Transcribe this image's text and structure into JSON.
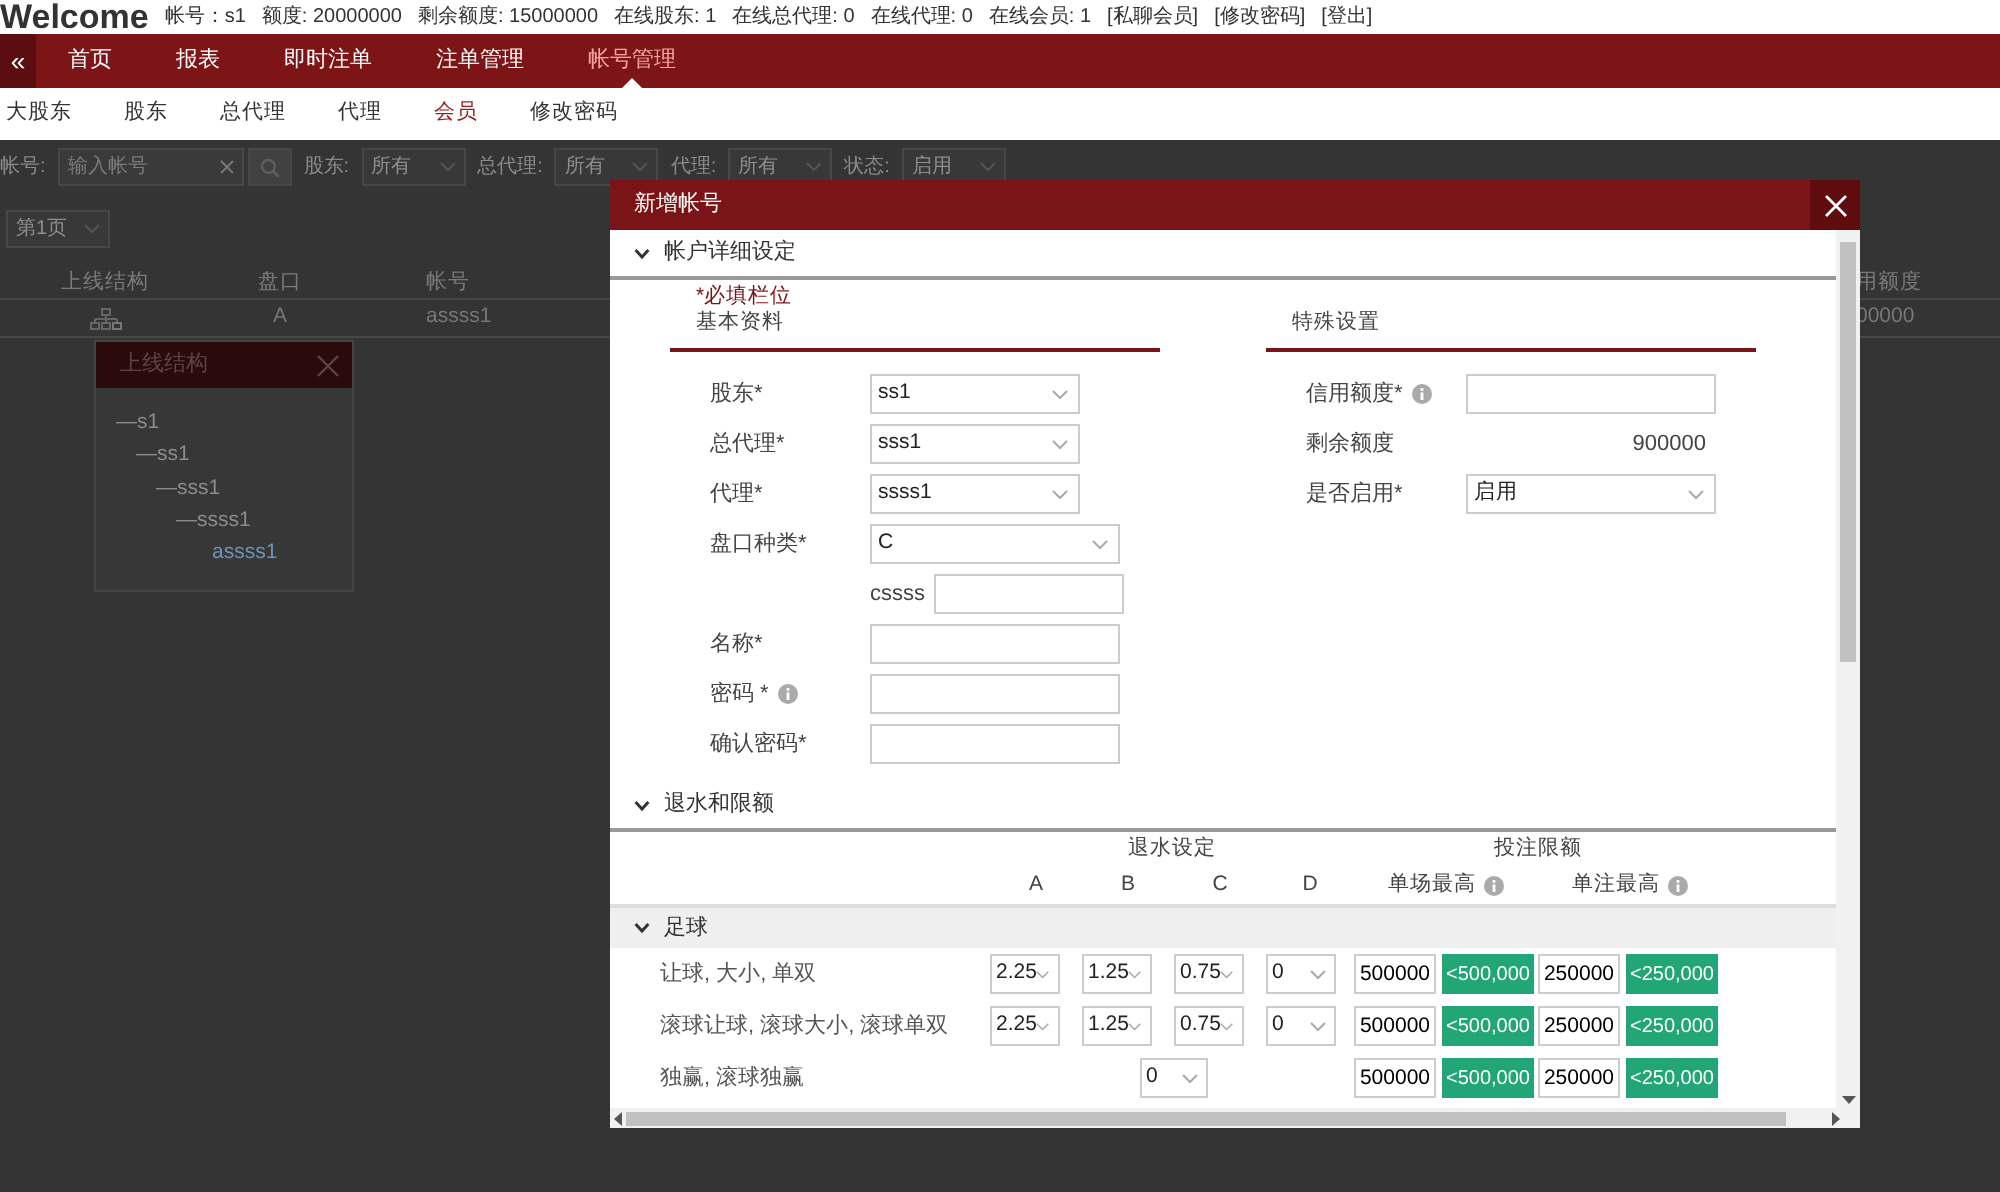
{
  "top_bar": {
    "title": "Welcome",
    "stats": [
      "帐号：s1",
      "额度: 20000000",
      "剩余额度: 15000000",
      "在线股东: 1",
      "在线总代理: 0",
      "在线代理: 0",
      "在线会员: 1"
    ],
    "links": [
      "[私聊会员]",
      "[修改密码]",
      "[登出]"
    ]
  },
  "main_nav": {
    "toggle": "«",
    "items": [
      {
        "label": "首页",
        "selected": false
      },
      {
        "label": "报表",
        "selected": false
      },
      {
        "label": "即时注单",
        "selected": false
      },
      {
        "label": "注单管理",
        "selected": false
      },
      {
        "label": "帐号管理",
        "selected": true
      }
    ]
  },
  "sub_nav": {
    "items": [
      {
        "label": "大股东",
        "selected": false
      },
      {
        "label": "股东",
        "selected": false
      },
      {
        "label": "总代理",
        "selected": false
      },
      {
        "label": "代理",
        "selected": false
      },
      {
        "label": "会员",
        "selected": true
      },
      {
        "label": "修改密码",
        "selected": false
      }
    ]
  },
  "filters": {
    "account": {
      "label": "帐号:",
      "placeholder": "输入帐号"
    },
    "selects": [
      {
        "label": "股东:",
        "value": "所有"
      },
      {
        "label": "总代理:",
        "value": "所有"
      },
      {
        "label": "代理:",
        "value": "所有"
      },
      {
        "label": "状态:",
        "value": "启用"
      }
    ]
  },
  "pager": {
    "value": "第1页"
  },
  "table": {
    "columns": [
      "上线结构",
      "盘口",
      "帐号",
      "用额度"
    ],
    "rows": [
      {
        "cells": [
          {
            "kind": "icon"
          },
          {
            "kind": "text",
            "text": "A"
          },
          {
            "kind": "text",
            "text": "assss1"
          },
          {
            "kind": "text",
            "text": "00000"
          }
        ]
      }
    ]
  },
  "structure_popup": {
    "title": "上线结构",
    "tree": [
      {
        "label": "—s1",
        "selected": false,
        "children": [
          {
            "label": "—ss1",
            "selected": false,
            "children": [
              {
                "label": "—sss1",
                "selected": false,
                "children": [
                  {
                    "label": "—ssss1",
                    "selected": false,
                    "children": [
                      {
                        "label": "assss1",
                        "selected": true
                      }
                    ]
                  }
                ]
              }
            ]
          }
        ]
      }
    ]
  },
  "modal": {
    "title": "新增帐号",
    "sections": [
      {
        "kind": "form",
        "title": "帐户详细设定",
        "expanded": true,
        "note": "*必填栏位",
        "basic": {
          "title": "基本资料",
          "fields": [
            {
              "kind": "select",
              "label": "股东*",
              "value": "ss1"
            },
            {
              "kind": "select",
              "label": "总代理*",
              "value": "sss1"
            },
            {
              "kind": "select",
              "label": "代理*",
              "value": "ssss1"
            },
            {
              "kind": "select",
              "label": "盘口种类*",
              "value": "C"
            },
            {
              "kind": "prefixed_input",
              "prefix": "cssss"
            },
            {
              "kind": "input",
              "label": "名称*"
            },
            {
              "kind": "input",
              "label": "密码 *",
              "info": true
            },
            {
              "kind": "input",
              "label": "确认密码*"
            }
          ]
        },
        "special": {
          "title": "特殊设置",
          "fields": [
            {
              "kind": "input",
              "label": "信用额度*",
              "info": true
            },
            {
              "kind": "text",
              "label": "剩余额度",
              "value": "900000"
            },
            {
              "kind": "select",
              "label": "是否启用*",
              "value": "启用"
            }
          ]
        }
      },
      {
        "kind": "limits",
        "title": "退水和限额",
        "expanded": true,
        "group_headers": [
          "退水设定",
          "投注限额"
        ],
        "columns": [
          {
            "label": "A"
          },
          {
            "label": "B"
          },
          {
            "label": "C"
          },
          {
            "label": "D"
          },
          {
            "label": "单场最高",
            "info": true
          },
          {
            "label": "单注最高",
            "info": true
          }
        ],
        "categories": [
          {
            "name": "足球",
            "expanded": true,
            "rows": [
              {
                "kind": "tiers",
                "label": "让球, 大小, 单双",
                "rebates": [
                  "2.25",
                  "1.25",
                  "0.75",
                  "0"
                ],
                "limits": [
                  {
                    "value": "500000",
                    "button": "<500,000"
                  },
                  {
                    "value": "250000",
                    "button": "<250,000"
                  }
                ]
              },
              {
                "kind": "tiers",
                "label": "滚球让球, 滚球大小, 滚球单双",
                "rebates": [
                  "2.25",
                  "1.25",
                  "0.75",
                  "0"
                ],
                "limits": [
                  {
                    "value": "500000",
                    "button": "<500,000"
                  },
                  {
                    "value": "250000",
                    "button": "<250,000"
                  }
                ]
              },
              {
                "kind": "single",
                "label": "独赢, 滚球独赢",
                "rebates": [
                  "0"
                ],
                "limits": [
                  {
                    "value": "500000",
                    "button": "<500,000"
                  },
                  {
                    "value": "250000",
                    "button": "<250,000"
                  }
                ]
              }
            ]
          }
        ]
      }
    ]
  }
}
